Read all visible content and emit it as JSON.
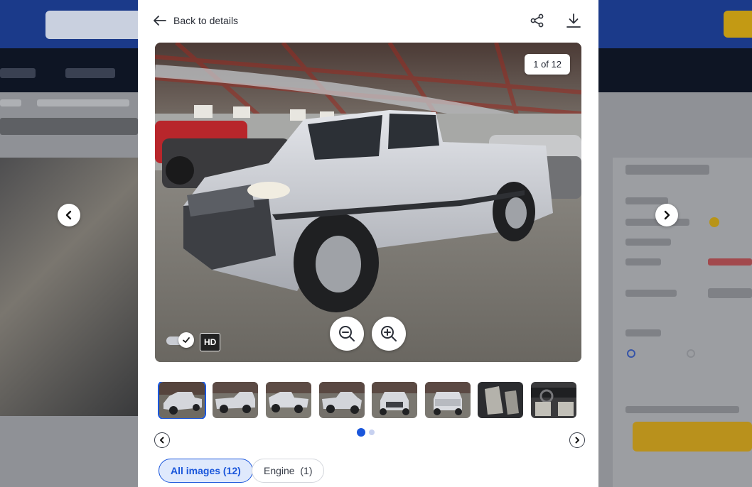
{
  "modal": {
    "back_label": "Back to details",
    "counter": "1 of 12",
    "hd_label": "HD",
    "hd_enabled": true
  },
  "thumbnails": [
    {
      "name": "thumb-front-left",
      "active": true
    },
    {
      "name": "thumb-rear-left",
      "active": false
    },
    {
      "name": "thumb-rear-right",
      "active": false
    },
    {
      "name": "thumb-front-right",
      "active": false
    },
    {
      "name": "thumb-front",
      "active": false
    },
    {
      "name": "thumb-rear",
      "active": false
    },
    {
      "name": "thumb-interior-seats",
      "active": false
    },
    {
      "name": "thumb-interior-dash",
      "active": false
    }
  ],
  "pager": {
    "pages": 2,
    "current": 1
  },
  "filters": [
    {
      "label": "All images (12)",
      "active": true
    },
    {
      "label": "Engine  (1)",
      "active": false
    }
  ],
  "colors": {
    "accent": "#1a56db",
    "header": "#1b3a8a",
    "bid_button": "#f5c21b"
  },
  "icons": {
    "back": "arrow-left-icon",
    "share": "share-icon",
    "download": "download-icon",
    "zoom_out": "zoom-out-icon",
    "zoom_in": "zoom-in-icon",
    "prev": "chevron-left-icon",
    "next": "chevron-right-icon"
  }
}
